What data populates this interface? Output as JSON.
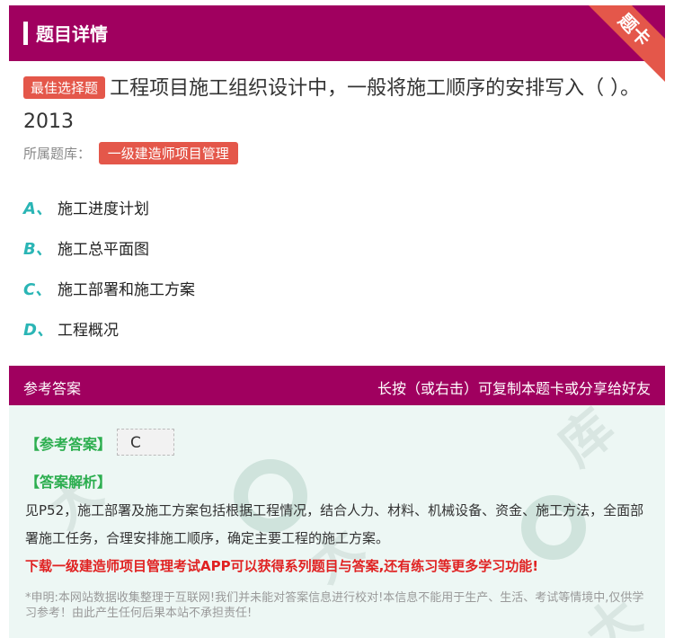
{
  "header": {
    "title": "题目详情",
    "ribbon": "题卡"
  },
  "question": {
    "type_badge": "最佳选择题",
    "text": "工程项目施工组织设计中，一般将施工顺序的安排写入（ ）。2013",
    "library_label": "所属题库：",
    "library_name": "一级建造师项目管理"
  },
  "options": [
    {
      "letter": "A、",
      "text": "施工进度计划"
    },
    {
      "letter": "B、",
      "text": "施工总平面图"
    },
    {
      "letter": "C、",
      "text": "施工部署和施工方案"
    },
    {
      "letter": "D、",
      "text": "工程概况"
    }
  ],
  "answer_section": {
    "title": "参考答案",
    "hint": "长按（或右击）可复制本题卡或分享给好友",
    "ref_label": "【参考答案】",
    "ref_value": "C",
    "analysis_label": "【答案解析】",
    "analysis_text": "见P52，施工部署及施工方案包括根据工程情况，结合人力、材料、机械设备、资金、施工方法，全面部署施工任务，合理安排施工顺序，确定主要工程的施工方案。",
    "promo": "下载一级建造师项目管理考试APP可以获得系列题目与答案,还有练习等更多学习功能!",
    "disclaimer": "*申明:本网站数据收集整理于互联网!我们并未能对答案信息进行校对!本信息不能用于生产、生活、考试等情境中,仅供学习参考！由此产生任何后果本站不承担责任!"
  },
  "colors": {
    "brand": "#a0005f",
    "accent": "#e4574a",
    "option_letter": "#2ab5b5",
    "answer_green": "#2cae4f",
    "promo_red": "#e02222"
  }
}
